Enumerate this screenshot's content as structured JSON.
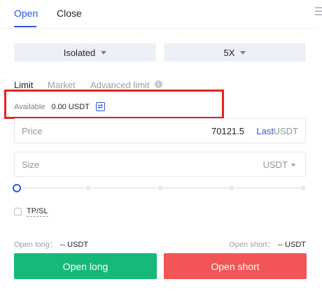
{
  "tabs": {
    "open": "Open",
    "close": "Close"
  },
  "margin_mode": {
    "selected": "Isolated"
  },
  "leverage": {
    "selected": "5X"
  },
  "order_types": {
    "limit": "Limit",
    "market": "Market",
    "advanced": "Advanced limit"
  },
  "info_icon_glyph": "i",
  "available": {
    "label": "Available",
    "value": "0.00 USDT",
    "transfer_glyph": "⇄"
  },
  "price": {
    "label": "Price",
    "value": "70121.5",
    "last": "Last",
    "unit": "USDT"
  },
  "size": {
    "label": "Size",
    "unit": "USDT"
  },
  "slider": {
    "level_percent": 0
  },
  "tpsl": {
    "label": "TP/SL",
    "checked": false
  },
  "open_long_info": {
    "label": "Open long：",
    "value": "-- USDT"
  },
  "open_short_info": {
    "label": "Open short：",
    "value": "-- USDT"
  },
  "buttons": {
    "open_long": "Open long",
    "open_short": "Open short"
  },
  "colors": {
    "accent": "#2f54eb",
    "long": "#16b979",
    "short": "#f25555",
    "highlight": "#e8231f"
  },
  "icons": [
    "menu-icon",
    "info-icon",
    "transfer-icon",
    "chevron-down-icon"
  ]
}
